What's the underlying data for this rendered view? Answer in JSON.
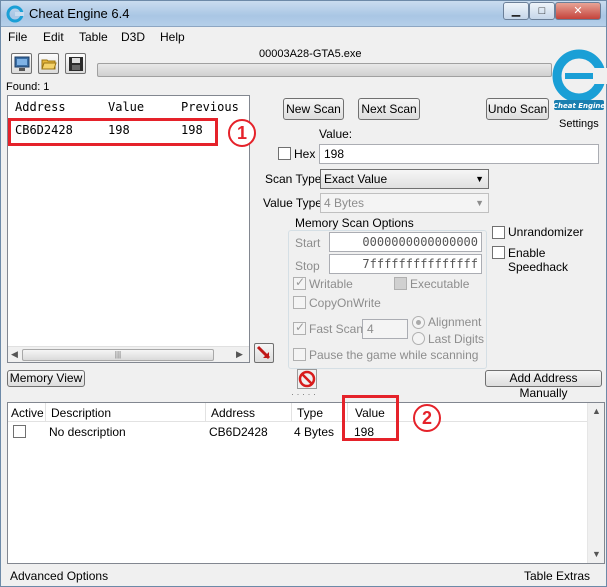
{
  "window": {
    "title": "Cheat Engine 6.4"
  },
  "menu": {
    "items": [
      "File",
      "Edit",
      "Table",
      "D3D",
      "Help"
    ]
  },
  "process": {
    "title": "00003A28-GTA5.exe"
  },
  "found": {
    "label": "Found: 1"
  },
  "settings": {
    "label": "Settings"
  },
  "logo": {
    "text": "Cheat Engine"
  },
  "results": {
    "headers": [
      "Address",
      "Value",
      "Previous"
    ],
    "rows": [
      {
        "address": "CB6D2428",
        "value": "198",
        "previous": "198"
      }
    ]
  },
  "scan": {
    "new_scan": "New Scan",
    "next_scan": "Next Scan",
    "undo_scan": "Undo Scan",
    "value_label": "Value:",
    "hex_label": "Hex",
    "value": "198",
    "scan_type_label": "Scan Type",
    "scan_type": "Exact Value",
    "value_type_label": "Value Type",
    "value_type": "4 Bytes"
  },
  "memory_options": {
    "title": "Memory Scan Options",
    "start_label": "Start",
    "start_value": "0000000000000000",
    "stop_label": "Stop",
    "stop_value": "7fffffffffffffff",
    "writable": "Writable",
    "executable": "Executable",
    "copy_on_write": "CopyOnWrite",
    "fast_scan": "Fast Scan",
    "fast_scan_value": "4",
    "alignment": "Alignment",
    "last_digits": "Last Digits",
    "pause_game": "Pause the game while scanning"
  },
  "extra_options": {
    "unrandomizer": "Unrandomizer",
    "speedhack": "Enable Speedhack"
  },
  "buttons": {
    "memory_view": "Memory View",
    "add_address": "Add Address Manually"
  },
  "cheat_table": {
    "headers": [
      "Active",
      "Description",
      "Address",
      "Type",
      "Value"
    ],
    "rows": [
      {
        "description": "No description",
        "address": "CB6D2428",
        "type": "4 Bytes",
        "value": "198"
      }
    ]
  },
  "status": {
    "advanced": "Advanced Options",
    "table_extras": "Table Extras"
  },
  "annotations": {
    "badge1": "1",
    "badge2": "2"
  },
  "colors": {
    "highlight": "#e5222a",
    "logo": "#1a9fd6"
  }
}
